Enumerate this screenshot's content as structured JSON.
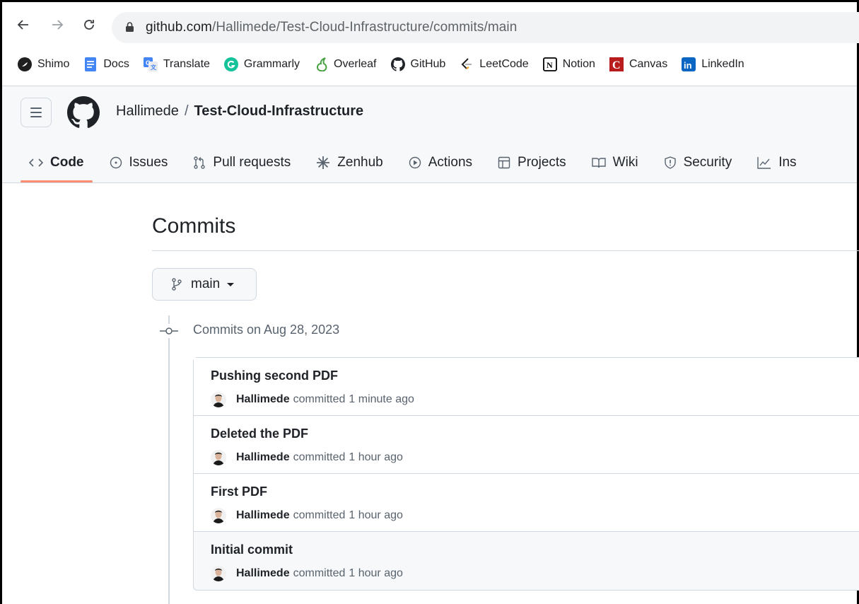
{
  "browser": {
    "url_host": "github.com",
    "url_path": "/Hallimede/Test-Cloud-Infrastructure/commits/main",
    "bookmarks": [
      {
        "label": "Shimo",
        "icon": "shimo-icon",
        "color": "#1f1f1f"
      },
      {
        "label": "Docs",
        "icon": "docs-icon",
        "color": "#4285f4"
      },
      {
        "label": "Translate",
        "icon": "translate-icon",
        "color": "#4285f4"
      },
      {
        "label": "Grammarly",
        "icon": "grammarly-icon",
        "color": "#15c39a"
      },
      {
        "label": "Overleaf",
        "icon": "overleaf-icon",
        "color": "#47a141"
      },
      {
        "label": "GitHub",
        "icon": "github-icon",
        "color": "#1f2328"
      },
      {
        "label": "LeetCode",
        "icon": "leetcode-icon",
        "color": "#ffa116"
      },
      {
        "label": "Notion",
        "icon": "notion-icon",
        "color": "#000000"
      },
      {
        "label": "Canvas",
        "icon": "canvas-icon",
        "color": "#b91c1c"
      },
      {
        "label": "LinkedIn",
        "icon": "linkedin-icon",
        "color": "#0a66c2"
      }
    ]
  },
  "repo": {
    "owner": "Hallimede",
    "separator": "/",
    "name": "Test-Cloud-Infrastructure"
  },
  "tabs": [
    {
      "label": "Code",
      "icon": "code-icon",
      "active": true
    },
    {
      "label": "Issues",
      "icon": "issue-icon",
      "active": false
    },
    {
      "label": "Pull requests",
      "icon": "pull-request-icon",
      "active": false
    },
    {
      "label": "Zenhub",
      "icon": "zenhub-icon",
      "active": false
    },
    {
      "label": "Actions",
      "icon": "play-icon",
      "active": false
    },
    {
      "label": "Projects",
      "icon": "table-icon",
      "active": false
    },
    {
      "label": "Wiki",
      "icon": "book-icon",
      "active": false
    },
    {
      "label": "Security",
      "icon": "shield-icon",
      "active": false
    },
    {
      "label": "Ins",
      "icon": "graph-icon",
      "active": false
    }
  ],
  "page": {
    "title": "Commits",
    "branch": "main",
    "group_heading": "Commits on Aug 28, 2023"
  },
  "commits": [
    {
      "title": "Pushing second PDF",
      "author": "Hallimede",
      "verb": "committed",
      "time": "1 minute ago"
    },
    {
      "title": "Deleted the PDF",
      "author": "Hallimede",
      "verb": "committed",
      "time": "1 hour ago"
    },
    {
      "title": "First PDF",
      "author": "Hallimede",
      "verb": "committed",
      "time": "1 hour ago"
    },
    {
      "title": "Initial commit",
      "author": "Hallimede",
      "verb": "committed",
      "time": "1 hour ago"
    }
  ],
  "colors": {
    "accent_underline": "#fd8c73",
    "border": "#d0d7de",
    "muted_text": "#59636e"
  }
}
